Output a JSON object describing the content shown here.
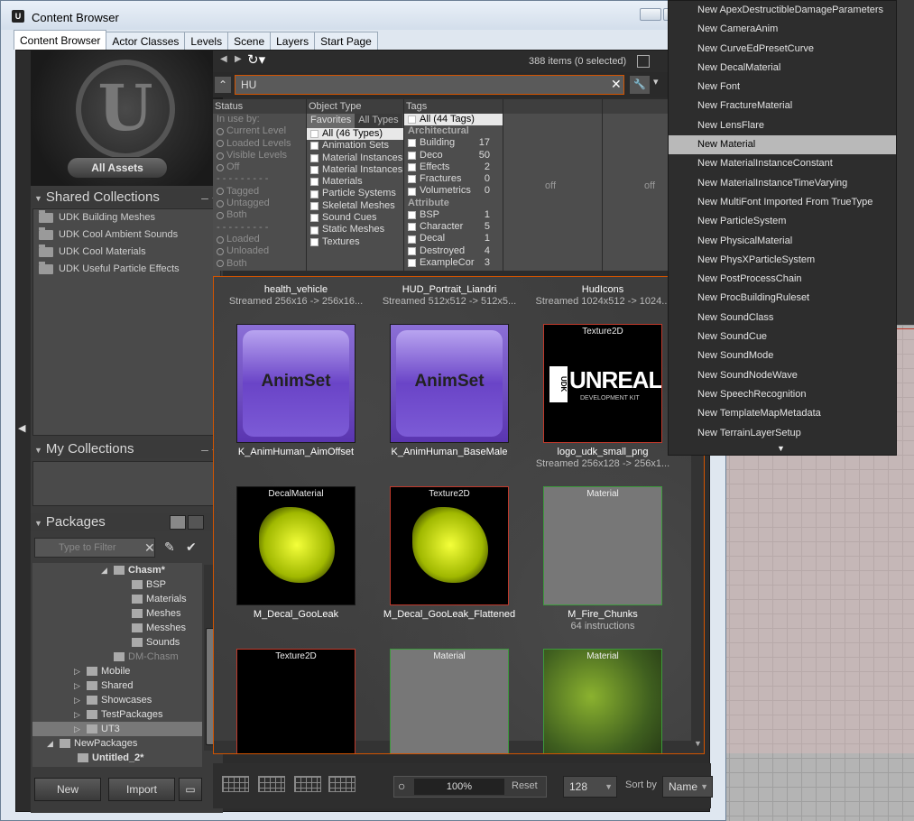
{
  "window": {
    "title": "Content Browser"
  },
  "tabs": [
    "Content Browser",
    "Actor Classes",
    "Levels",
    "Scene",
    "Layers",
    "Start Page"
  ],
  "left_panel": {
    "all_assets_label": "All Assets",
    "shared_collections": {
      "title": "Shared Collections",
      "items": [
        "UDK Building Meshes",
        "UDK Cool Ambient Sounds",
        "UDK Cool Materials",
        "UDK Useful Particle Effects"
      ]
    },
    "my_collections": {
      "title": "My Collections"
    },
    "packages": {
      "title": "Packages",
      "filter_placeholder": "Type to Filter",
      "tree": [
        {
          "label": "Chasm*",
          "indent": 90,
          "arrow": "◢",
          "bold": true
        },
        {
          "label": "BSP",
          "indent": 110
        },
        {
          "label": "Materials",
          "indent": 110
        },
        {
          "label": "Meshes",
          "indent": 110
        },
        {
          "label": "Messhes",
          "indent": 110
        },
        {
          "label": "Sounds",
          "indent": 110
        },
        {
          "label": "DM-Chasm",
          "indent": 90,
          "dim": true
        },
        {
          "label": "Mobile",
          "indent": 60,
          "arrow": "▷"
        },
        {
          "label": "Shared",
          "indent": 60,
          "arrow": "▷"
        },
        {
          "label": "Showcases",
          "indent": 60,
          "arrow": "▷"
        },
        {
          "label": "TestPackages",
          "indent": 60,
          "arrow": "▷"
        },
        {
          "label": "UT3",
          "indent": 60,
          "arrow": "▷",
          "selected": true
        },
        {
          "label": "NewPackages",
          "indent": 30,
          "arrow": "◢"
        },
        {
          "label": "Untitled_2*",
          "indent": 50,
          "bold": true
        }
      ]
    },
    "buttons": {
      "new": "New",
      "import": "Import"
    }
  },
  "search": {
    "items_count": "388 items (0 selected)",
    "query": "HU",
    "clear_label": "Clea"
  },
  "filters": {
    "status": {
      "title": "Status",
      "in_use_label": "In use by:",
      "options": [
        "Current Level",
        "Loaded Levels",
        "Visible Levels",
        "Off"
      ],
      "tag_options": [
        "Tagged",
        "Untagged",
        "Both"
      ],
      "load_options": [
        "Loaded",
        "Unloaded",
        "Both"
      ]
    },
    "object_type": {
      "title": "Object Type",
      "tab_favorites": "Favorites",
      "tab_all": "All Types",
      "items": [
        "All (46 Types)",
        "Animation Sets",
        "Material Instances",
        "Material Instances",
        "Materials",
        "Particle Systems",
        "Skeletal Meshes",
        "Sound Cues",
        "Static Meshes",
        "Textures"
      ]
    },
    "tags": {
      "title": "Tags",
      "all_label": "All (44 Tags)",
      "group_architectural": "Architectural",
      "architectural": [
        {
          "name": "Building",
          "count": "17"
        },
        {
          "name": "Deco",
          "count": "50"
        },
        {
          "name": "Effects",
          "count": "2"
        },
        {
          "name": "Fractures",
          "count": "0"
        },
        {
          "name": "Volumetrics",
          "count": "0"
        }
      ],
      "group_attribute": "Attribute",
      "attribute": [
        {
          "name": "BSP",
          "count": "1"
        },
        {
          "name": "Character",
          "count": "5"
        },
        {
          "name": "Decal",
          "count": "1"
        },
        {
          "name": "Destroyed",
          "count": "4"
        },
        {
          "name": "ExampleCor",
          "count": "3"
        }
      ]
    },
    "off_label": "off"
  },
  "assets": {
    "row0": [
      {
        "name": "health_vehicle",
        "info": "Streamed 256x16 -> 256x16..."
      },
      {
        "name": "HUD_Portrait_Liandri",
        "info": "Streamed 512x512 -> 512x5..."
      },
      {
        "name": "HudIcons",
        "info": "Streamed 1024x512 -> 1024..."
      }
    ],
    "row1": [
      {
        "name": "K_AnimHuman_AimOffset",
        "thumb_text": "AnimSet"
      },
      {
        "name": "K_AnimHuman_BaseMale",
        "thumb_text": "AnimSet"
      },
      {
        "name": "logo_udk_small_png",
        "info": "Streamed 256x128 -> 256x1...",
        "type": "Texture2D",
        "logo_main": "UNREAL",
        "logo_sub": "DEVELOPMENT KIT",
        "logo_badge": "UDK"
      }
    ],
    "row2": [
      {
        "name": "M_Decal_GooLeak",
        "type": "DecalMaterial"
      },
      {
        "name": "M_Decal_GooLeak_Flattened",
        "type": "Texture2D"
      },
      {
        "name": "M_Fire_Chunks",
        "info": "64 instructions",
        "type": "Material"
      }
    ],
    "row3": [
      {
        "type": "Texture2D"
      },
      {
        "type": "Material"
      },
      {
        "type": "Material"
      }
    ]
  },
  "bottom": {
    "zoom": "100%",
    "reset": "Reset",
    "size": "128",
    "sort_label": "Sort by",
    "sort_value": "Name"
  },
  "menu": {
    "items": [
      "New ApexDestructibleDamageParameters",
      "New CameraAnim",
      "New CurveEdPresetCurve",
      "New DecalMaterial",
      "New Font",
      "New FractureMaterial",
      "New LensFlare",
      "New Material",
      "New MaterialInstanceConstant",
      "New MaterialInstanceTimeVarying",
      "New MultiFont Imported From TrueType",
      "New ParticleSystem",
      "New PhysicalMaterial",
      "New PhysXParticleSystem",
      "New PostProcessChain",
      "New ProcBuildingRuleset",
      "New SoundClass",
      "New SoundCue",
      "New SoundMode",
      "New SoundNodeWave",
      "New SpeechRecognition",
      "New TemplateMapMetadata",
      "New TerrainLayerSetup"
    ],
    "highlighted_index": 7
  }
}
